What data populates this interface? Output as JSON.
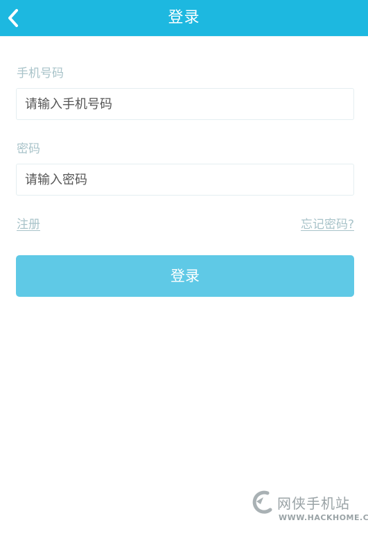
{
  "header": {
    "title": "登录",
    "back_icon": "chevron-left-icon",
    "background_color": "#1db8e0"
  },
  "form": {
    "phone": {
      "label": "手机号码",
      "placeholder": "请输入手机号码",
      "value": ""
    },
    "password": {
      "label": "密码",
      "placeholder": "请输入密码",
      "value": ""
    },
    "register_link": "注册",
    "forgot_link": "忘记密码?",
    "login_button": "登录",
    "button_color": "#5fc9e6"
  },
  "watermark": {
    "name": "网侠手机站",
    "url": "WWW.HACKHOME.COM"
  }
}
